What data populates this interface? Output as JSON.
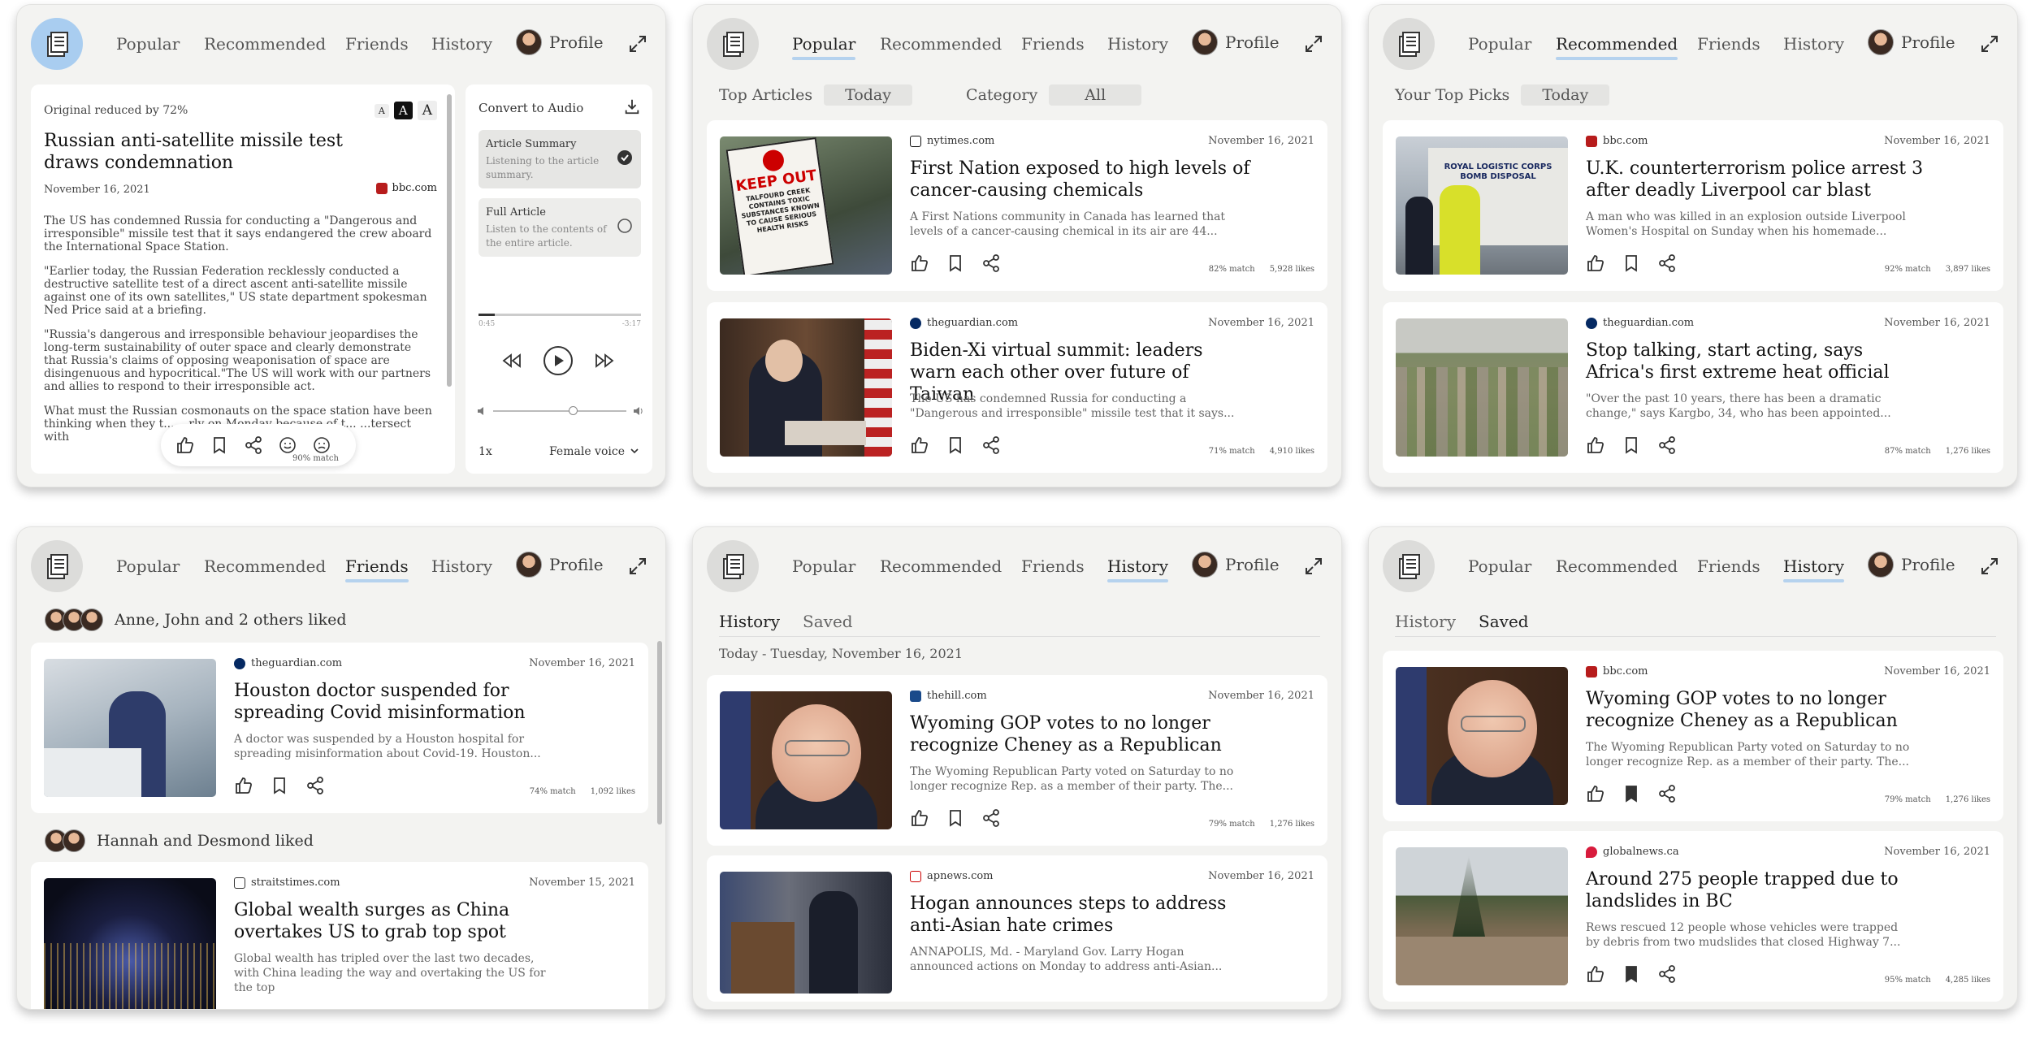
{
  "nav": {
    "popular": "Popular",
    "recommended": "Recommended",
    "friends": "Friends",
    "history": "History",
    "profile": "Profile"
  },
  "reader": {
    "reduced": "Original reduced by 72%",
    "font_small": "A",
    "font_mid": "A",
    "font_large": "A",
    "title": "Russian anti-satellite missile test draws condemnation",
    "date": "November 16, 2021",
    "source": "bbc.com",
    "paras": [
      "The US has condemned Russia for conducting a \"Dangerous and irresponsible\" missile test that it says endangered the crew aboard the International Space Station.",
      "\"Earlier today, the Russian Federation recklessly conducted a destructive satellite test of a direct ascent anti-satellite missile against one of its own satellites,\" US state department spokesman Ned Price said at a briefing.",
      "\"Russia's dangerous and irresponsible behaviour jeopardises the long-term sustainability of outer space and clearly demonstrate that Russia's claims of opposing weaponisation of space are disingenuous and hypocritical.\"The US will work with our partners and allies to respond to their irresponsible act.",
      "What must the Russian cosmonauts on the space station have been thinking when they t... ...rly on Monday because of t... ...tersect with"
    ],
    "match": "90% match"
  },
  "audio": {
    "title": "Convert to Audio",
    "opt1_title": "Article Summary",
    "opt1_desc": "Listening to the article summary.",
    "opt2_title": "Full Article",
    "opt2_desc": "Listen to the contents of the entire article.",
    "elapsed": "0:45",
    "remaining": "-3:17",
    "speed": "1x",
    "voice": "Female voice",
    "progress": 0.1,
    "volume": 0.6
  },
  "popular": {
    "label1": "Top Articles",
    "pill1": "Today",
    "label2": "Category",
    "pill2": "All"
  },
  "recommended": {
    "label": "Your Top Picks",
    "pill": "Today"
  },
  "history_tabs": {
    "history": "History",
    "saved": "Saved",
    "date_header": "Today - Tuesday, November 16, 2021"
  },
  "friends": {
    "group1": "Anne, John and 2 others liked",
    "group2": "Hannah and Desmond liked"
  },
  "cards": {
    "p2a": {
      "source": "nytimes.com",
      "date": "November 16, 2021",
      "title": "First Nation exposed to high levels of cancer-causing chemicals",
      "summary": "A First Nations community in Canada has learned that levels of a cancer-causing chemical in its air are 44...",
      "match": "82% match",
      "likes": "5,928 likes",
      "sign1": "KEEP OUT",
      "sign2": "TALFOURD CREEK CONTAINS TOXIC SUBSTANCES KNOWN TO CAUSE SERIOUS HEALTH RISKS"
    },
    "p2b": {
      "source": "theguardian.com",
      "date": "November 16, 2021",
      "title": "Biden-Xi virtual summit: leaders warn each other over future of Taiwan",
      "summary": "The US has condemned Russia for conducting a \"Dangerous and irresponsible\" missile test that it says...",
      "match": "71% match",
      "likes": "4,910 likes"
    },
    "p3a": {
      "source": "bbc.com",
      "date": "November 16, 2021",
      "title": "U.K. counterterrorism police arrest 3 after deadly Liverpool car blast",
      "summary": "A man who was killed in an explosion outside Liverpool Women's Hospital on Sunday when his homemade...",
      "match": "92% match",
      "likes": "3,897 likes",
      "truck": "ROYAL LOGISTIC CORPS BOMB DISPOSAL"
    },
    "p3b": {
      "source": "theguardian.com",
      "date": "November 16, 2021",
      "title": "Stop talking, start acting, says Africa's first extreme heat official",
      "summary": "\"Over the past 10 years, there has been a dramatic change,\" says Kargbo, 34, who has been appointed...",
      "match": "87% match",
      "likes": "1,276 likes"
    },
    "p4a": {
      "source": "theguardian.com",
      "date": "November 16, 2021",
      "title": "Houston doctor suspended for spreading Covid misinformation",
      "summary": "A doctor was suspended by a Houston hospital for spreading misinformation about Covid-19. Houston...",
      "match": "74% match",
      "likes": "1,092 likes"
    },
    "p4b": {
      "source": "straitstimes.com",
      "date": "November 15, 2021",
      "title": "Global wealth surges as China overtakes US to grab top spot",
      "summary": "Global wealth has tripled over the last two decades, with China leading the way and overtaking the US for the top"
    },
    "p5a": {
      "source": "thehill.com",
      "date": "November 16, 2021",
      "title": "Wyoming GOP votes to no longer recognize Cheney as a Republican",
      "summary": "The Wyoming Republican Party voted on Saturday to no longer recognize Rep. as a member of their party. The...",
      "match": "79% match",
      "likes": "1,276 likes"
    },
    "p5b": {
      "source": "apnews.com",
      "date": "November 16, 2021",
      "title": "Hogan announces steps to address anti-Asian hate crimes",
      "summary": "ANNAPOLIS, Md. - Maryland Gov. Larry Hogan announced actions on Monday to address anti-Asian..."
    },
    "p6a": {
      "source": "bbc.com",
      "date": "November 16, 2021",
      "title": "Wyoming GOP votes to no longer recognize Cheney as a Republican",
      "summary": "The Wyoming Republican Party voted on Saturday to no longer recognize Rep. as a member of their party. The...",
      "match": "79% match",
      "likes": "1,276 likes"
    },
    "p6b": {
      "source": "globalnews.ca",
      "date": "November 16, 2021",
      "title": "Around 275 people trapped due to landslides in BC",
      "summary": "Rews rescued 12 people whose vehicles were trapped by debris from two mudslides that closed Highway 7...",
      "match": "95% match",
      "likes": "4,285 likes"
    }
  }
}
